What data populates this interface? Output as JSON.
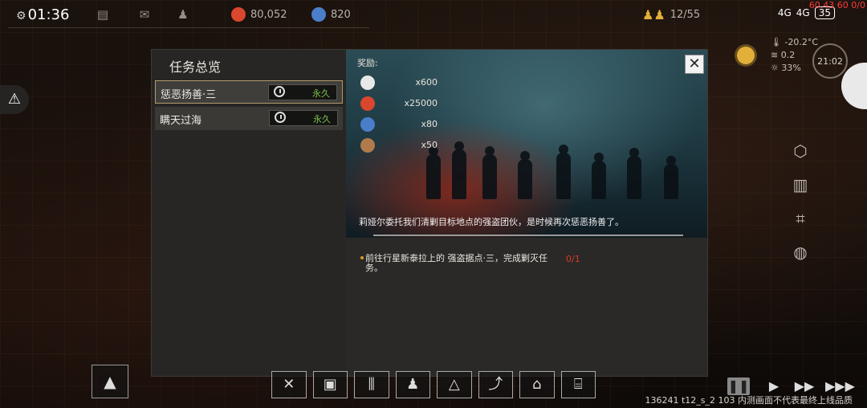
{
  "topbar": {
    "time": "01:36",
    "resources": [
      {
        "name": "food-icon",
        "value": "80,052",
        "color": "#d9482e"
      },
      {
        "name": "gear-coin-icon",
        "value": "820",
        "color": "#4a7ec9"
      }
    ],
    "population": "12/55",
    "signal_1": "4G",
    "signal_2": "4G",
    "battery": "35",
    "fps": "60.43 60 0/0"
  },
  "weather": {
    "temperature": "-20.2°C",
    "wind": "0.2",
    "sunlight": "33%",
    "clock": "21:02"
  },
  "dialog": {
    "title": "任务总览",
    "quests": [
      {
        "name": "惩恶扬善·三",
        "duration": "永久"
      },
      {
        "name": "瞒天过海",
        "duration": "永久"
      }
    ],
    "reward_label": "奖励:",
    "rewards": [
      {
        "name": "tech-chip-icon",
        "amount": "x600",
        "color": "#e8e8e8"
      },
      {
        "name": "food-icon",
        "amount": "x25000",
        "color": "#d9482e"
      },
      {
        "name": "gear-coin-icon",
        "amount": "x80",
        "color": "#4a7ec9"
      },
      {
        "name": "ore-icon",
        "amount": "x50",
        "color": "#b07a4a"
      }
    ],
    "close": "✕",
    "story": "莉娅尔委托我们清剿目标地点的强盗团伙，是时候再次惩恶扬善了。",
    "objective_line1": "前往行星新泰拉上的 强盗据点·三，完成剿灭任",
    "objective_line2": "务。",
    "objective_progress": "0/1"
  },
  "footer": {
    "version": "136241 t12_s_2 103",
    "disclaimer": "内测画面不代表最终上线品质"
  }
}
